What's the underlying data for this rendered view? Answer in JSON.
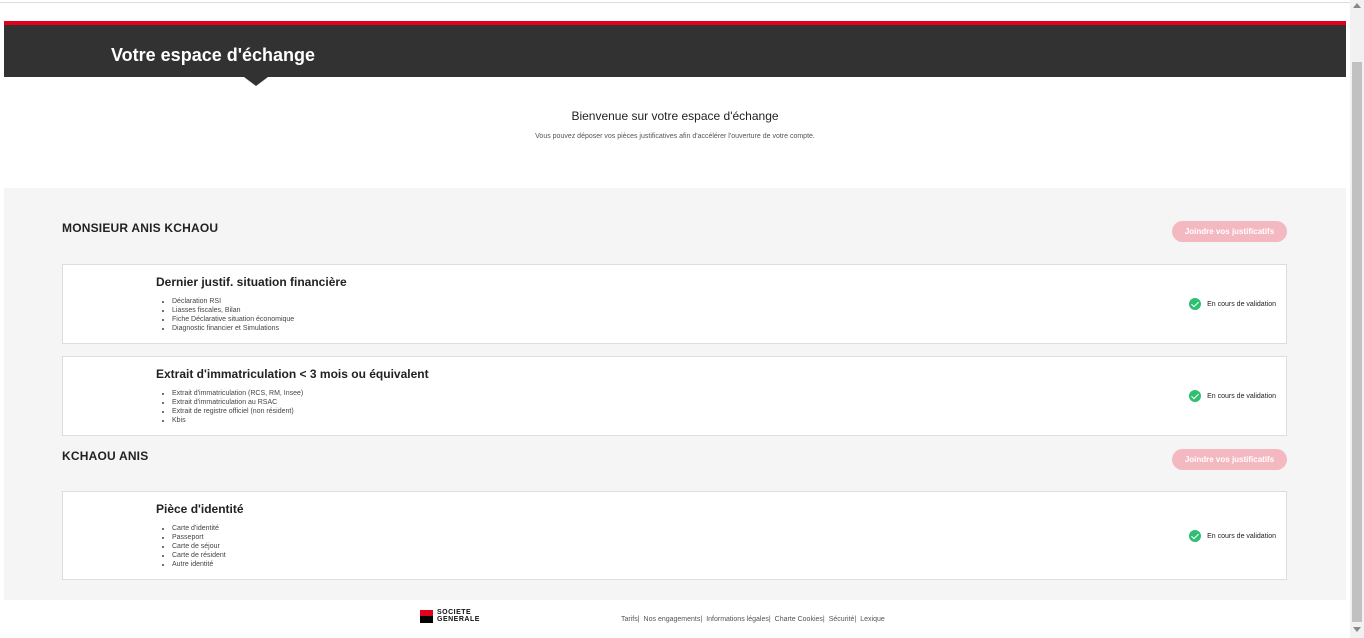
{
  "header": {
    "title": "Votre espace d'échange"
  },
  "welcome": {
    "title": "Bienvenue sur votre espace d'échange",
    "subtitle": "Vous pouvez déposer vos pièces justificatives afin d'accélérer l'ouverture de votre compte."
  },
  "sections": [
    {
      "name": "MONSIEUR ANIS KCHAOU",
      "join_label": "Joindre vos justificatifs",
      "cards": [
        {
          "title": "Dernier justif. situation financière",
          "items": [
            "Déclaration RSI",
            "Liasses fiscales, Bilan",
            "Fiche Déclarative situation économique",
            "Diagnostic financier et Simulations"
          ],
          "status": "En cours de validation"
        },
        {
          "title": "Extrait d'immatriculation < 3 mois ou équivalent",
          "items": [
            "Extrait d'immatriculation (RCS, RM, Insee)",
            "Extrait d'immatriculation au RSAC",
            "Extrait de registre officiel (non résident)",
            "Kbis"
          ],
          "status": "En cours de validation"
        }
      ]
    },
    {
      "name": "KCHAOU ANIS",
      "join_label": "Joindre vos justificatifs",
      "cards": [
        {
          "title": "Pièce d'identité",
          "items": [
            "Carte d'identité",
            "Passeport",
            "Carte de séjour",
            "Carte de résident",
            "Autre identité"
          ],
          "status": "En cours de validation"
        }
      ]
    }
  ],
  "footer": {
    "logo_line1": "SOCIETE",
    "logo_line2": "GENERALE",
    "links": [
      "Tarifs|",
      "Nos engagements|",
      "Informations légales|",
      "Charte Cookies|",
      "Sécurité|",
      "Lexique"
    ]
  },
  "colors": {
    "brand_red": "#e2001a",
    "header_dark": "#333233",
    "check_green": "#2fbf71",
    "button_pink": "#f4b8c0"
  },
  "icons": {
    "status": "check-circle-icon"
  }
}
